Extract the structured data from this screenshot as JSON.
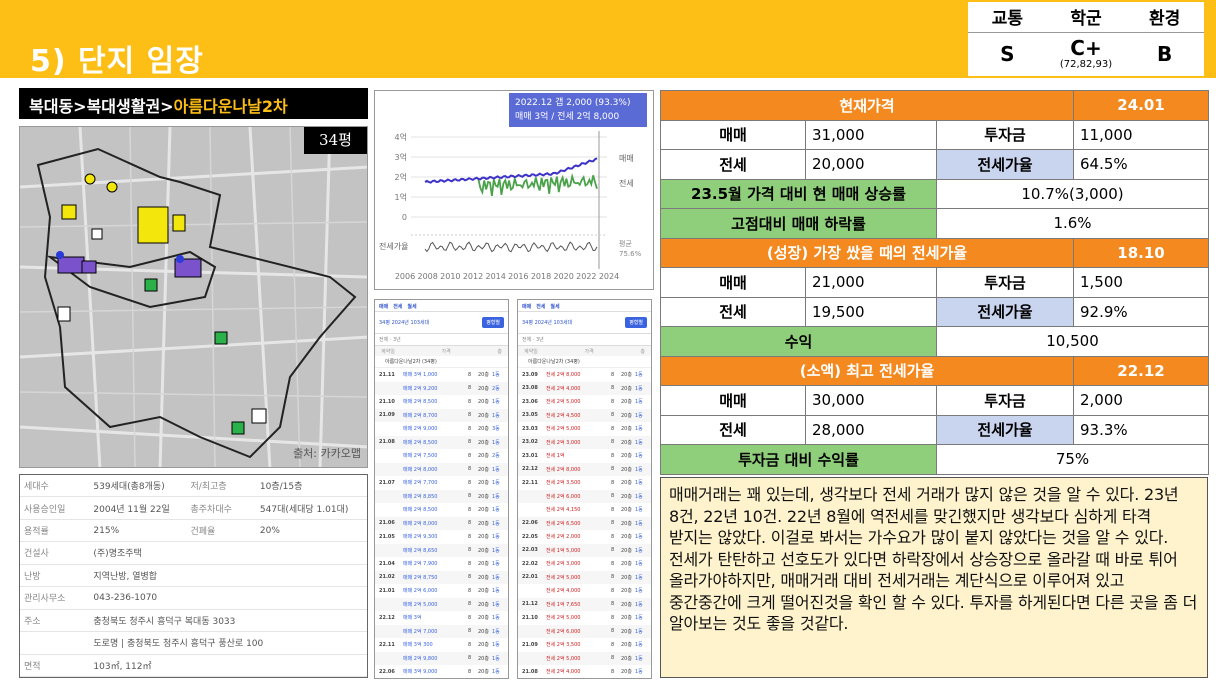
{
  "header": {
    "title": "5) 단지 임장",
    "rating": {
      "labels": [
        "교통",
        "학군",
        "환경"
      ],
      "values": [
        "S",
        "C+",
        "B"
      ],
      "school_sub": "(72,82,93)"
    }
  },
  "breadcrumb": {
    "path": "복대동>복대생활권>",
    "complex": "아름다운나날2차"
  },
  "map": {
    "pyeong_badge": "34평",
    "source": "출처: 카카오맵"
  },
  "info": {
    "rows": [
      {
        "l1": "세대수",
        "v1": "539세대(총8개동)",
        "l2": "저/최고층",
        "v2": "10층/15층"
      },
      {
        "l1": "사용승인일",
        "v1": "2004년 11월 22일",
        "l2": "총주차대수",
        "v2": "547대(세대당 1.01대)"
      },
      {
        "l1": "용적률",
        "v1": "215%",
        "l2": "건폐율",
        "v2": "20%"
      },
      {
        "l1": "건설사",
        "v1": "(주)명조주택",
        "l2": "",
        "v2": ""
      },
      {
        "l1": "난방",
        "v1": "지역난방, 열병합",
        "l2": "",
        "v2": ""
      },
      {
        "l1": "관리사무소",
        "v1": "043-236-1070",
        "l2": "",
        "v2": ""
      },
      {
        "l1": "주소",
        "v1": "충청북도 청주시 흥덕구 복대동 3033",
        "l2": "",
        "v2": ""
      },
      {
        "l1": "",
        "v1": "도로명 | 충청북도 청주시 흥덕구 풍산로 100",
        "l2": "",
        "v2": ""
      },
      {
        "l1": "면적",
        "v1": "103㎡, 112㎡",
        "l2": "",
        "v2": ""
      }
    ]
  },
  "price_chart": {
    "tooltip_line1": "2022.12  갭 2,000 (93.3%)",
    "tooltip_line2": "매매 3억 / 전세 2억 8,000",
    "y_ticks": [
      "4억",
      "3억",
      "2억",
      "1억",
      "0"
    ],
    "x_ticks": [
      "2006",
      "2008",
      "2010",
      "2012",
      "2014",
      "2016",
      "2018",
      "2020",
      "2022",
      "2024"
    ],
    "label_sale": "매매",
    "label_jeonse": "전세",
    "label_ratio": "전세가율",
    "ratio_right": "평균",
    "ratio_value": "75.6%",
    "colors": {
      "sale": "#3d33c9",
      "jeonse": "#4aa24a",
      "ratio": "#555555"
    }
  },
  "transactions": {
    "left": {
      "tabs": [
        "매매",
        "전세",
        "월세"
      ],
      "size": "34평",
      "year": "2024년",
      "households": "103세대",
      "button": "평형별",
      "filter": "전체 · 3년",
      "cols": [
        "계약일",
        "가격",
        "층"
      ],
      "addr": "아름다운나날2차 (34평)",
      "rows": [
        {
          "d": "21.11",
          "k": "매매 3억 1,000",
          "f": "8",
          "c": "20층",
          "t": "1동"
        },
        {
          "d": "",
          "k": "매매 2억 9,200",
          "f": "8",
          "c": "20층",
          "t": "2동"
        },
        {
          "d": "21.10",
          "k": "매매 2억 8,500",
          "f": "8",
          "c": "20층",
          "t": "1동"
        },
        {
          "d": "21.09",
          "k": "매매 2억 8,700",
          "f": "8",
          "c": "20층",
          "t": "1동"
        },
        {
          "d": "",
          "k": "매매 2억 9,000",
          "f": "8",
          "c": "20층",
          "t": "3동"
        },
        {
          "d": "21.08",
          "k": "매매 2억 8,500",
          "f": "8",
          "c": "20층",
          "t": "1동"
        },
        {
          "d": "",
          "k": "매매 2억 7,500",
          "f": "8",
          "c": "20층",
          "t": "2동"
        },
        {
          "d": "",
          "k": "매매 2억 8,000",
          "f": "8",
          "c": "20층",
          "t": "1동"
        },
        {
          "d": "21.07",
          "k": "매매 2억 7,700",
          "f": "8",
          "c": "20층",
          "t": "1동"
        },
        {
          "d": "",
          "k": "매매 2억 8,850",
          "f": "8",
          "c": "20층",
          "t": "1동"
        },
        {
          "d": "",
          "k": "매매 2억 8,500",
          "f": "8",
          "c": "20층",
          "t": "1동"
        },
        {
          "d": "21.06",
          "k": "매매 2억 8,000",
          "f": "8",
          "c": "20층",
          "t": "1동"
        },
        {
          "d": "21.05",
          "k": "매매 2억 9,300",
          "f": "8",
          "c": "20층",
          "t": "1동"
        },
        {
          "d": "",
          "k": "매매 2억 8,650",
          "f": "8",
          "c": "20층",
          "t": "1동"
        },
        {
          "d": "21.04",
          "k": "매매 2억 7,900",
          "f": "8",
          "c": "20층",
          "t": "1동"
        },
        {
          "d": "21.02",
          "k": "매매 2억 8,750",
          "f": "8",
          "c": "20층",
          "t": "1동"
        },
        {
          "d": "21.01",
          "k": "매매 2억 6,000",
          "f": "8",
          "c": "20층",
          "t": "1동"
        },
        {
          "d": "",
          "k": "매매 2억 5,000",
          "f": "8",
          "c": "20층",
          "t": "1동"
        },
        {
          "d": "22.12",
          "k": "매매 3억",
          "f": "8",
          "c": "20층",
          "t": "1동"
        },
        {
          "d": "",
          "k": "매매 2억 7,000",
          "f": "8",
          "c": "20층",
          "t": "1동"
        },
        {
          "d": "22.11",
          "k": "매매 3억 300",
          "f": "8",
          "c": "20층",
          "t": "1동"
        },
        {
          "d": "",
          "k": "매매 2억 9,800",
          "f": "8",
          "c": "20층",
          "t": "1동"
        },
        {
          "d": "22.06",
          "k": "매매 3억 9,000",
          "f": "8",
          "c": "20층",
          "t": "1동"
        }
      ]
    },
    "right": {
      "tabs": [
        "매매",
        "전세",
        "월세"
      ],
      "size": "34평",
      "year": "2024년",
      "households": "103세대",
      "button": "평형별",
      "filter": "전체 · 3년",
      "cols": [
        "계약일",
        "가격",
        "층"
      ],
      "addr": "아름다운나날2차 (34평)",
      "rows": [
        {
          "d": "23.09",
          "k": "전세 2억 8,000",
          "f": "8",
          "c": "20층",
          "t": "1동"
        },
        {
          "d": "23.08",
          "k": "전세 2억 4,000",
          "f": "8",
          "c": "20층",
          "t": "1동"
        },
        {
          "d": "23.06",
          "k": "전세 2억 5,000",
          "f": "8",
          "c": "20층",
          "t": "1동"
        },
        {
          "d": "23.05",
          "k": "전세 2억 4,500",
          "f": "8",
          "c": "20층",
          "t": "1동"
        },
        {
          "d": "23.03",
          "k": "전세 2억 5,000",
          "f": "8",
          "c": "20층",
          "t": "1동"
        },
        {
          "d": "23.02",
          "k": "전세 2억 3,000",
          "f": "8",
          "c": "20층",
          "t": "1동"
        },
        {
          "d": "23.01",
          "k": "전세 1억",
          "f": "8",
          "c": "20층",
          "t": "1동"
        },
        {
          "d": "22.12",
          "k": "전세 2억 8,000",
          "f": "8",
          "c": "20층",
          "t": "1동"
        },
        {
          "d": "22.11",
          "k": "전세 2억 3,500",
          "f": "8",
          "c": "20층",
          "t": "1동"
        },
        {
          "d": "",
          "k": "전세 2억 6,000",
          "f": "8",
          "c": "20층",
          "t": "1동"
        },
        {
          "d": "",
          "k": "전세 2억 4,150",
          "f": "8",
          "c": "20층",
          "t": "1동"
        },
        {
          "d": "22.06",
          "k": "전세 2억 6,500",
          "f": "8",
          "c": "20층",
          "t": "1동"
        },
        {
          "d": "22.05",
          "k": "전세 2억 2,000",
          "f": "8",
          "c": "20층",
          "t": "1동"
        },
        {
          "d": "22.03",
          "k": "전세 1억 5,000",
          "f": "8",
          "c": "20층",
          "t": "1동"
        },
        {
          "d": "22.02",
          "k": "전세 2억 3,000",
          "f": "8",
          "c": "20층",
          "t": "1동"
        },
        {
          "d": "22.01",
          "k": "전세 2억 5,000",
          "f": "8",
          "c": "20층",
          "t": "1동"
        },
        {
          "d": "",
          "k": "전세 2억 4,000",
          "f": "8",
          "c": "20층",
          "t": "1동"
        },
        {
          "d": "21.12",
          "k": "전세 1억 7,650",
          "f": "8",
          "c": "20층",
          "t": "1동"
        },
        {
          "d": "21.10",
          "k": "전세 2억 5,000",
          "f": "8",
          "c": "20층",
          "t": "1동"
        },
        {
          "d": "",
          "k": "전세 2억 6,000",
          "f": "8",
          "c": "20층",
          "t": "1동"
        },
        {
          "d": "21.09",
          "k": "전세 2억 3,500",
          "f": "8",
          "c": "20층",
          "t": "1동"
        },
        {
          "d": "",
          "k": "전세 2억 5,000",
          "f": "8",
          "c": "20층",
          "t": "1동"
        },
        {
          "d": "21.08",
          "k": "전세 2억 4,000",
          "f": "8",
          "c": "20층",
          "t": "1동"
        }
      ]
    }
  },
  "price_table": {
    "current": {
      "label": "현재가격",
      "date": "24.01"
    },
    "cur_sale_label": "매매",
    "cur_sale": "31,000",
    "cur_invest_label": "투자금",
    "cur_invest": "11,000",
    "cur_jeonse_label": "전세",
    "cur_jeonse": "20,000",
    "cur_ratio_label": "전세가율",
    "cur_ratio": "64.5%",
    "rise_label": "23.5월 가격 대비 현 매매 상승률",
    "rise_value": "10.7%(3,000)",
    "drop_label": "고점대비 매매 하락률",
    "drop_value": "1.6%",
    "growth": {
      "label": "(성장) 가장 쌌을 때의 전세가율",
      "date": "18.10"
    },
    "gr_sale_label": "매매",
    "gr_sale": "21,000",
    "gr_invest_label": "투자금",
    "gr_invest": "1,500",
    "gr_jeonse_label": "전세",
    "gr_jeonse": "19,500",
    "gr_ratio_label": "전세가율",
    "gr_ratio": "92.9%",
    "profit_label": "수익",
    "profit_value": "10,500",
    "shrink": {
      "label": "(소액) 최고 전세가율",
      "date": "22.12"
    },
    "sh_sale_label": "매매",
    "sh_sale": "30,000",
    "sh_invest_label": "투자금",
    "sh_invest": "2,000",
    "sh_jeonse_label": "전세",
    "sh_jeonse": "28,000",
    "sh_ratio_label": "전세가율",
    "sh_ratio": "93.3%",
    "yield_label": "투자금 대비 수익률",
    "yield_value": "75%"
  },
  "comment": "매매거래는 꽤 있는데, 생각보다 전세 거래가 많지 않은 것을 알 수 있다. 23년 8건, 22년 10건. 22년 8월에 역전세를 맞긴했지만 생각보다 심하게 타격 받지는 않았다. 이걸로 봐서는 가수요가 많이 붙지 않았다는 것을 알 수 있다. 전세가 탄탄하고 선호도가 있다면 하락장에서 상승장으로 올라갈 때 바로 튀어 올라가야하지만, 매매거래 대비 전세거래는 계단식으로 이루어져 있고 중간중간에 크게 떨어진것을 확인 할 수 있다. 투자를 하게된다면 다른 곳을 좀 더 알아보는 것도 좋을 것같다."
}
